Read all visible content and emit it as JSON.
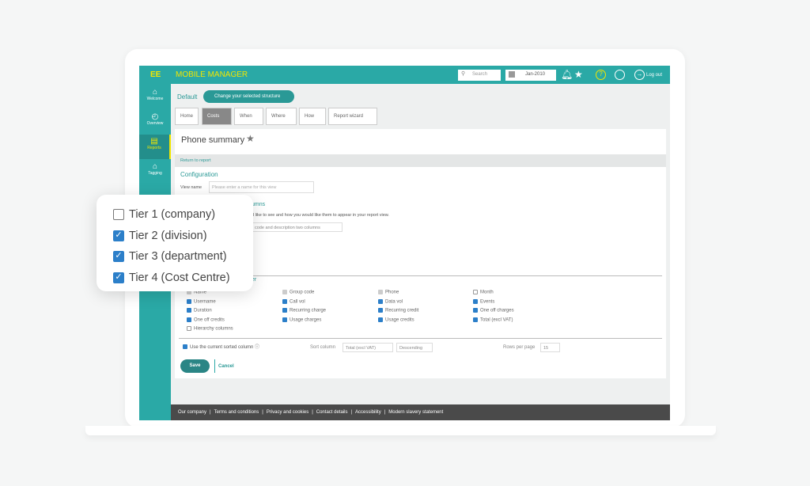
{
  "header": {
    "logo": "EE",
    "title": "MOBILE MANAGER",
    "search_placeholder": "Search",
    "date": "Jan-2010",
    "logout": "Log out"
  },
  "sidebar": {
    "items": [
      {
        "label": "Welcome"
      },
      {
        "label": "Overview"
      },
      {
        "label": "Reports"
      },
      {
        "label": "Tagging"
      }
    ]
  },
  "structure": {
    "label": "Default",
    "button": "Change your selected structure"
  },
  "tabs": [
    "Home",
    "Costs",
    "When",
    "Where",
    "How",
    "Report wizard"
  ],
  "page": {
    "title": "Phone summary",
    "return": "Return to report",
    "config": "Configuration",
    "view_name_label": "View name",
    "view_name_placeholder": "Please enter a name for this view",
    "columns_heading": "umns",
    "columns_desc": "d like to see and how you would like them to appear in your report view.",
    "columns_select": "code and description two columns",
    "order_heading": "er"
  },
  "columns": [
    [
      {
        "label": "Name",
        "state": "disabled"
      },
      {
        "label": "Username",
        "state": "on"
      },
      {
        "label": "Duration",
        "state": "on"
      },
      {
        "label": "One off credits",
        "state": "on"
      },
      {
        "label": "Hierarchy columns",
        "state": "off"
      }
    ],
    [
      {
        "label": "Group code",
        "state": "disabled"
      },
      {
        "label": "Call vol",
        "state": "on"
      },
      {
        "label": "Recurring charge",
        "state": "on"
      },
      {
        "label": "Usage charges",
        "state": "on"
      }
    ],
    [
      {
        "label": "Phone",
        "state": "disabled"
      },
      {
        "label": "Data vol",
        "state": "on"
      },
      {
        "label": "Recurring credit",
        "state": "on"
      },
      {
        "label": "Usage credits",
        "state": "on"
      }
    ],
    [
      {
        "label": "Month",
        "state": "off"
      },
      {
        "label": "Events",
        "state": "on"
      },
      {
        "label": "One off charges",
        "state": "on"
      },
      {
        "label": "Total (excl VAT)",
        "state": "on"
      }
    ]
  ],
  "sorting": {
    "use_current": "Use the current sorted column",
    "sort_label": "Sort column",
    "sort_value": "Total (excl VAT)",
    "order_value": "Descending",
    "rows_label": "Rows per page",
    "rows_value": "15"
  },
  "actions": {
    "save": "Save",
    "cancel": "Cancel"
  },
  "footer": [
    "Our company",
    "Terms and conditions",
    "Privacy and cookies",
    "Contact details",
    "Accessibility",
    "Modern slavery statement"
  ],
  "popup": [
    {
      "label": "Tier 1 (company)",
      "checked": false
    },
    {
      "label": "Tier 2 (division)",
      "checked": true
    },
    {
      "label": "Tier 3 (department)",
      "checked": true
    },
    {
      "label": "Tier 4 (Cost Centre)",
      "checked": true
    }
  ],
  "colors": {
    "brand": "#2aa9a6",
    "accent": "#f2e600",
    "checkbox": "#2c7fc9"
  }
}
